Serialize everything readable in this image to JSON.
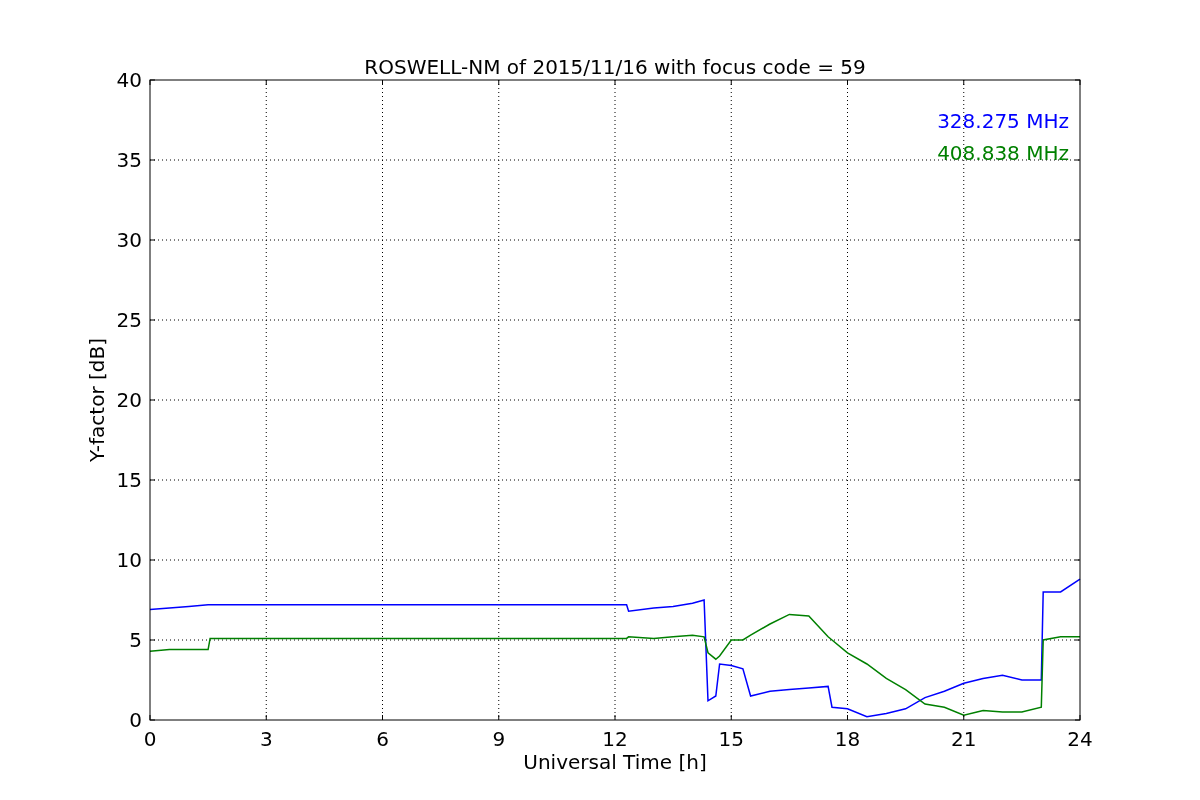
{
  "chart_data": {
    "type": "line",
    "title": "ROSWELL-NM of 2015/11/16 with focus code = 59",
    "xlabel": "Universal Time [h]",
    "ylabel": "Y-factor [dB]",
    "x": [
      0,
      0.5,
      1,
      1.5,
      1.55,
      3,
      6,
      9,
      12,
      12.3,
      12.35,
      13,
      13.5,
      14,
      14.3,
      14.4,
      14.6,
      14.7,
      15,
      15.3,
      15.5,
      16,
      16.5,
      17,
      17.5,
      17.6,
      18,
      18.5,
      19,
      19.5,
      20,
      20.5,
      21,
      21.5,
      22,
      22.5,
      23,
      23.05,
      23.5,
      24
    ],
    "series": [
      {
        "name": "328.275 MHz",
        "color": "#0000ff",
        "values": [
          6.9,
          7.0,
          7.1,
          7.2,
          7.2,
          7.2,
          7.2,
          7.2,
          7.2,
          7.2,
          6.8,
          7.0,
          7.1,
          7.3,
          7.5,
          1.2,
          1.5,
          3.5,
          3.4,
          3.2,
          1.5,
          1.8,
          1.9,
          2.0,
          2.1,
          0.8,
          0.7,
          0.2,
          0.4,
          0.7,
          1.4,
          1.8,
          2.3,
          2.6,
          2.8,
          2.5,
          2.5,
          8.0,
          8.0,
          8.8
        ]
      },
      {
        "name": "408.838 MHz",
        "color": "#008000",
        "values": [
          4.3,
          4.4,
          4.4,
          4.4,
          5.1,
          5.1,
          5.1,
          5.1,
          5.1,
          5.1,
          5.2,
          5.1,
          5.2,
          5.3,
          5.2,
          4.2,
          3.8,
          4.0,
          5.0,
          5.0,
          5.3,
          6.0,
          6.6,
          6.5,
          5.2,
          5.0,
          4.2,
          3.5,
          2.6,
          1.9,
          1.0,
          0.8,
          0.3,
          0.6,
          0.5,
          0.5,
          0.8,
          5.0,
          5.2,
          5.2
        ]
      }
    ],
    "xlim": [
      0,
      24
    ],
    "ylim": [
      0,
      40
    ],
    "xticks": [
      0,
      3,
      6,
      9,
      12,
      15,
      18,
      21,
      24
    ],
    "yticks": [
      0,
      5,
      10,
      15,
      20,
      25,
      30,
      35,
      40
    ],
    "grid": true
  }
}
